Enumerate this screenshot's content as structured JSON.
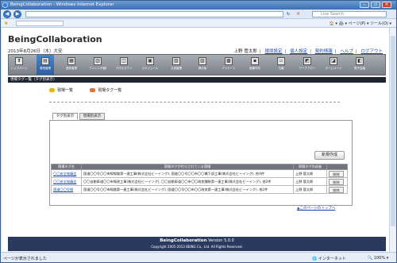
{
  "browser": {
    "title": "BeingCollaboration - Windows Internet Explorer",
    "search_placeholder": "Live Search",
    "tools_label": "🏠 ▾  🖨 ▾  ページ(P) ▾  ツール(O) ▾"
  },
  "header": {
    "brand": "BeingCollaboration",
    "date": "2013年8月26日（木）大安",
    "user": "上野 管太郎",
    "links": [
      "環境設定",
      "個人設定",
      "契約情報",
      "ヘルプ",
      "ログアウト"
    ]
  },
  "toolbar": [
    {
      "label": "トップページ",
      "icon": "⬆",
      "active": false
    },
    {
      "label": "環境管理",
      "icon": "▤",
      "active": true
    },
    {
      "label": "進捗管理",
      "icon": "▦",
      "active": false
    },
    {
      "label": "ワンレンダ管理",
      "icon": "▥",
      "active": false
    },
    {
      "label": "プロセスワリ",
      "icon": "◫",
      "active": false
    },
    {
      "label": "スケジュール",
      "icon": "▣",
      "active": false
    },
    {
      "label": "文書管理",
      "icon": "▧",
      "active": false
    },
    {
      "label": "掲示板",
      "icon": "▨",
      "active": false
    },
    {
      "label": "アンケート",
      "icon": "▩",
      "active": false
    },
    {
      "label": "設備予約",
      "icon": "▪",
      "active": false
    },
    {
      "label": "日報",
      "icon": "▫",
      "active": false
    },
    {
      "label": "ワークフロー",
      "icon": "◩",
      "active": false
    },
    {
      "label": "ホームページ",
      "icon": "◪",
      "active": false
    },
    {
      "label": "電子会議",
      "icon": "◧",
      "active": false
    }
  ],
  "breadcrumb": "現場タグ一覧（タグ別表示）",
  "links": {
    "site_list": "現場一覧",
    "tag_list": "現場タグ一覧"
  },
  "tabs": [
    "タグ別表示",
    "現場別表示"
  ],
  "new_button": "新規作成",
  "table": {
    "headers": [
      "現場タグ名",
      "現場タグが付与されている現場",
      "現場タグ作成者",
      ""
    ],
    "rows": [
      {
        "tag": "〇〇安全協議会",
        "sites": "国道〇〇号〇〇市線線路第一連工事(株式会社ビーイング), 国道〇〇号〇〇市〇〇橋下部工事(株式会社ビーイング), 他4件",
        "author": "上野 管太郎",
        "action": "削除"
      },
      {
        "tag": "〇〇安全協議会",
        "sites": "〇〇自動車道〇〇市線改工事(株式会社ビーイング), 〇〇自動車道〇〇市〇〇改良舗装第一連工事(株式会社ビーイング), 他2件",
        "author": "上野 管太郎",
        "action": "削除"
      },
      {
        "tag": "国道〇〇号線",
        "sites": "国道〇〇号〇〇市線路第一連工事(株式会社ビーイング), 国道〇〇号〇〇市〇〇改良第一連工事(株式会社ビーイング), 他2件",
        "author": "上野 管太郎",
        "action": "削除"
      }
    ]
  },
  "page_top": "▲このページのトップへ",
  "footer": {
    "brand": "BeingCollaboration",
    "version": "Version 5.0.0",
    "copyright": "Copyright 2005-2013 BEING Co., Ltd. All Rights Reserved."
  },
  "status": {
    "text": "ページが表示されました",
    "zone": "🌐 インターネット",
    "zoom": "🔍 100% ▾"
  },
  "colors": {
    "toolbar_active": "#2e5f9e",
    "breadcrumb_bg": "#1e2530",
    "footer_bg": "#2a3a5e",
    "link": "#1a45a8"
  }
}
